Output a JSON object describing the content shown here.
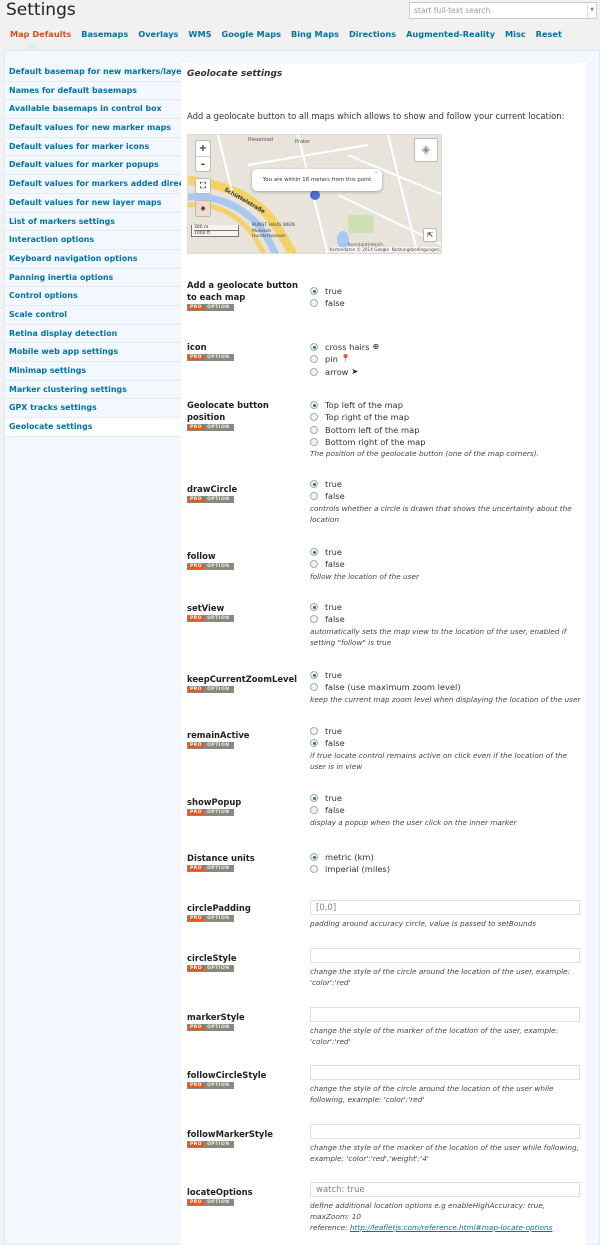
{
  "header": {
    "title": "Settings",
    "search_placeholder": "start full-text search"
  },
  "tabs": [
    {
      "label": "Map Defaults",
      "active": true
    },
    {
      "label": "Basemaps"
    },
    {
      "label": "Overlays"
    },
    {
      "label": "WMS"
    },
    {
      "label": "Google Maps"
    },
    {
      "label": "Bing Maps"
    },
    {
      "label": "Directions"
    },
    {
      "label": "Augmented-Reality"
    },
    {
      "label": "Misc"
    },
    {
      "label": "Reset"
    }
  ],
  "sidebar": [
    "Default basemap for new markers/layers",
    "Names for default basemaps",
    "Available basemaps in control box",
    "Default values for new marker maps",
    "Default values for marker icons",
    "Default values for marker popups",
    "Default values for markers added directly",
    "Default values for new layer maps",
    "List of markers settings",
    "Interaction options",
    "Keyboard navigation options",
    "Panning inertia options",
    "Control options",
    "Scale control",
    "Retina display detection",
    "Mobile web app settings",
    "Minimap settings",
    "Marker clustering settings",
    "GPX tracks settings",
    "Geolocate settings"
  ],
  "sidebar_active": "Geolocate settings",
  "section": {
    "title": "Geolocate settings",
    "intro": "Add a geolocate button to all maps which allows to show and follow your current location:"
  },
  "map": {
    "popup": "You are within 16 meters from this point",
    "labels": [
      "Riesenrad",
      "Prater",
      "Schüttelstraße",
      "KUNST HAUS WIEN. Museum Hundertwasser",
      "Konstantinteich"
    ],
    "scale_m": "300 m",
    "scale_ft": "1000 ft",
    "attribution": "Kartendaten © 2014 Google",
    "terms": "Nutzungsbedingungen",
    "zoom_in": "+",
    "zoom_out": "-"
  },
  "badge": {
    "pro": "PRO",
    "option": "OPTION"
  },
  "settings": [
    {
      "label": "Add a geolocate button to each map",
      "type": "radio",
      "options": [
        "true",
        "false"
      ],
      "selected": 0
    },
    {
      "label": "icon",
      "type": "radio",
      "options": [
        "cross hairs",
        "pin",
        "arrow"
      ],
      "icons": [
        "crosshairs-icon",
        "pin-icon",
        "arrow-icon"
      ],
      "selected": 0
    },
    {
      "label": "Geolocate button position",
      "type": "radio",
      "options": [
        "Top left of the map",
        "Top right of the map",
        "Bottom left of the map",
        "Bottom right of the map"
      ],
      "selected": 0,
      "desc": "The position of the geolocate button (one of the map corners)."
    },
    {
      "label": "drawCircle",
      "type": "radio",
      "options": [
        "true",
        "false"
      ],
      "selected": 0,
      "desc": "controls whether a circle is drawn that shows the uncertainty about the location"
    },
    {
      "label": "follow",
      "type": "radio",
      "options": [
        "true",
        "false"
      ],
      "selected": 0,
      "desc": "follow the location of the user"
    },
    {
      "label": "setView",
      "type": "radio",
      "options": [
        "true",
        "false"
      ],
      "selected": 0,
      "desc": "automatically sets the map view to the location of the user, enabled if setting \"follow\" is true"
    },
    {
      "label": "keepCurrentZoomLevel",
      "type": "radio",
      "options": [
        "true",
        "false (use maximum zoom level)"
      ],
      "selected": 0,
      "desc": "keep the current map zoom level when displaying the location of the user"
    },
    {
      "label": "remainActive",
      "type": "radio",
      "options": [
        "true",
        "false"
      ],
      "selected": 1,
      "desc": "if true locate control remains active on click even if the location of the user is in view"
    },
    {
      "label": "showPopup",
      "type": "radio",
      "options": [
        "true",
        "false"
      ],
      "selected": 0,
      "desc": "display a popup when the user click on the inner marker"
    },
    {
      "label": "Distance units",
      "type": "radio",
      "options": [
        "metric (km)",
        "imperial (miles)"
      ],
      "selected": 0
    },
    {
      "label": "circlePadding",
      "type": "text",
      "placeholder": "[0,0]",
      "value": "",
      "desc": "padding around accuracy circle, value is passed to setBounds"
    },
    {
      "label": "circleStyle",
      "type": "text",
      "placeholder": "",
      "value": "",
      "desc": "change the style of the circle around the location of the user, example: 'color':'red'"
    },
    {
      "label": "markerStyle",
      "type": "text",
      "placeholder": "",
      "value": "",
      "desc": "change the style of the marker of the location of the user, example: 'color':'red'"
    },
    {
      "label": "followCircleStyle",
      "type": "text",
      "placeholder": "",
      "value": "",
      "desc": "change the style of the circle around the location of the user while following, example: 'color':'red'"
    },
    {
      "label": "followMarkerStyle",
      "type": "text",
      "placeholder": "",
      "value": "",
      "desc": "change the style of the marker of the location of the user while following, example: 'color':'red','weight':'4'"
    },
    {
      "label": "locateOptions",
      "type": "text",
      "placeholder": "watch: true",
      "value": "",
      "desc": "define additional location options e.g enableHighAccuracy: true, maxZoom: 10",
      "ref_label": "reference:",
      "ref_link": "http://leafletjs.com/reference.html#map-locate-options"
    }
  ],
  "colors": {
    "link": "#0074a2",
    "active_tab": "#d54e21",
    "pro_badge": "#e5591d",
    "radio_selected": "#1e6fa8"
  }
}
